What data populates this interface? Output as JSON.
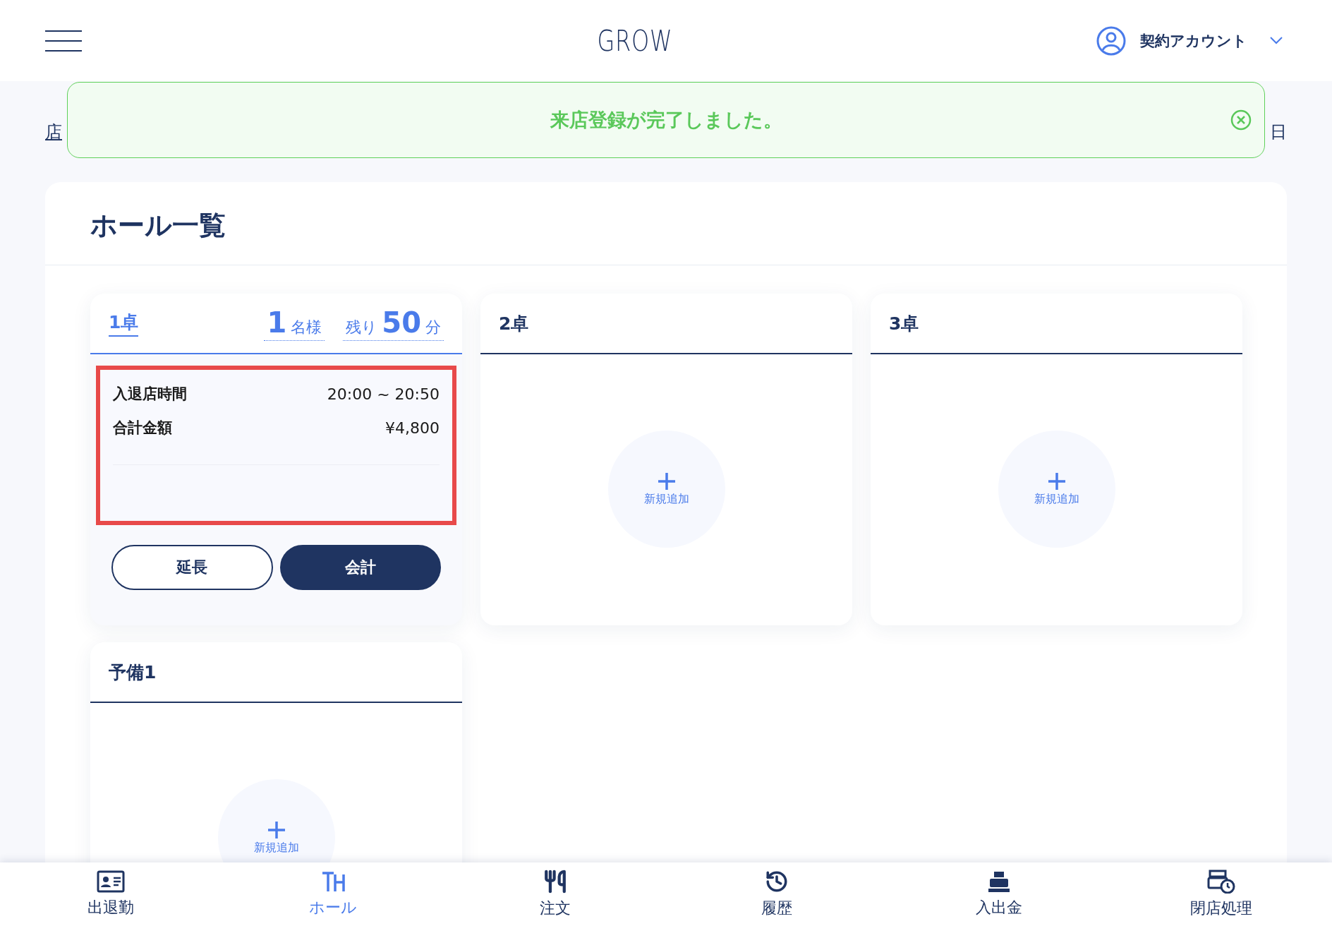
{
  "header": {
    "title": "GROW",
    "account": "契約アカウント"
  },
  "toast": {
    "message": "来店登録が完了しました。"
  },
  "breadcrumb": {
    "left": "店",
    "right": "日"
  },
  "panel": {
    "title": "ホール一覧"
  },
  "tables": [
    {
      "name": "1卓",
      "kind": "occupied",
      "guests": "1",
      "guests_unit": "名様",
      "remaining_label": "残り",
      "remaining": "50",
      "remaining_unit": "分",
      "highlighted": true,
      "details": [
        {
          "label": "入退店時間",
          "value": "20:00 ~ 20:50"
        },
        {
          "label": "合計金額",
          "value": "¥4,800"
        }
      ],
      "buttons": [
        {
          "label": "延長",
          "kind": "outline"
        },
        {
          "label": "会計",
          "kind": "filled"
        }
      ]
    },
    {
      "name": "2卓",
      "kind": "empty",
      "add_label": "新規追加"
    },
    {
      "name": "3卓",
      "kind": "empty",
      "add_label": "新規追加"
    },
    {
      "name": "予備1",
      "kind": "empty",
      "add_label": "新規追加"
    }
  ],
  "nav": [
    {
      "label": "出退勤",
      "kind": "idcard",
      "selected": false
    },
    {
      "label": "ホール",
      "kind": "hall",
      "selected": true
    },
    {
      "label": "注文",
      "kind": "utensils",
      "selected": false
    },
    {
      "label": "履歴",
      "kind": "history",
      "selected": false
    },
    {
      "label": "入出金",
      "kind": "register",
      "selected": false
    },
    {
      "label": "閉店処理",
      "kind": "closing",
      "selected": false
    }
  ]
}
